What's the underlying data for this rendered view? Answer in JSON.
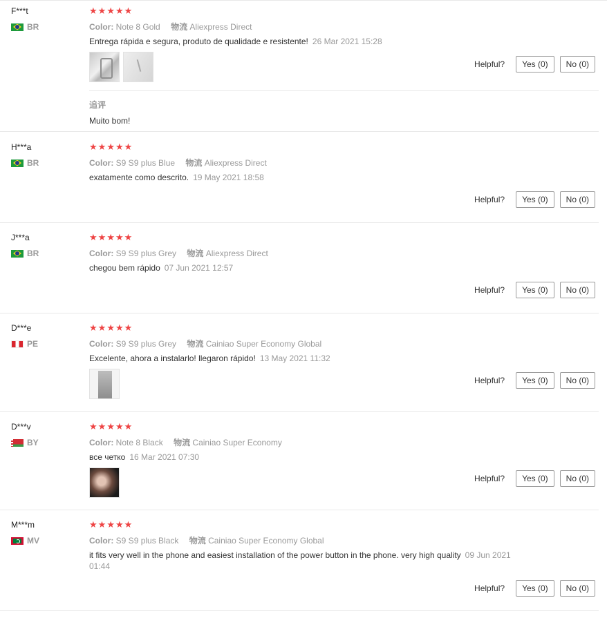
{
  "helpful_label": "Helpful?",
  "color_key": "Color:",
  "shipping_key": "物流",
  "reviews": [
    {
      "user": "F***t",
      "country": "BR",
      "color": "Note 8 Gold",
      "shipping": "Aliexpress Direct",
      "content": "Entrega rápida e segura, produto de qualidade e resistente!",
      "date": "26 Mar 2021 15:28",
      "yes": "Yes (0)",
      "no": "No (0)",
      "followup_label": "追评",
      "followup_text": "Muito bom!"
    },
    {
      "user": "H***a",
      "country": "BR",
      "color": "S9 S9 plus Blue",
      "shipping": "Aliexpress Direct",
      "content": "exatamente como descrito.",
      "date": "19 May 2021 18:58",
      "yes": "Yes (0)",
      "no": "No (0)"
    },
    {
      "user": "J***a",
      "country": "BR",
      "color": "S9 S9 plus Grey",
      "shipping": "Aliexpress Direct",
      "content": "chegou bem rápido",
      "date": "07 Jun 2021 12:57",
      "yes": "Yes (0)",
      "no": "No (0)"
    },
    {
      "user": "D***e",
      "country": "PE",
      "color": "S9 S9 plus Grey",
      "shipping": "Cainiao Super Economy Global",
      "content": "Excelente, ahora a instalarlo! llegaron rápido!",
      "date": "13 May 2021 11:32",
      "yes": "Yes (0)",
      "no": "No (0)"
    },
    {
      "user": "D***v",
      "country": "BY",
      "color": "Note 8 Black",
      "shipping": "Cainiao Super Economy",
      "content": "все четко",
      "date": "16 Mar 2021 07:30",
      "yes": "Yes (0)",
      "no": "No (0)"
    },
    {
      "user": "M***m",
      "country": "MV",
      "color": "S9 S9 plus Black",
      "shipping": "Cainiao Super Economy Global",
      "content": "it fits very well in the phone and easiest installation of the power button in the phone. very high quality",
      "date": "09 Jun 2021 01:44",
      "yes": "Yes (0)",
      "no": "No (0)"
    }
  ],
  "rating_stars": 5,
  "star_color": "#ee4444"
}
